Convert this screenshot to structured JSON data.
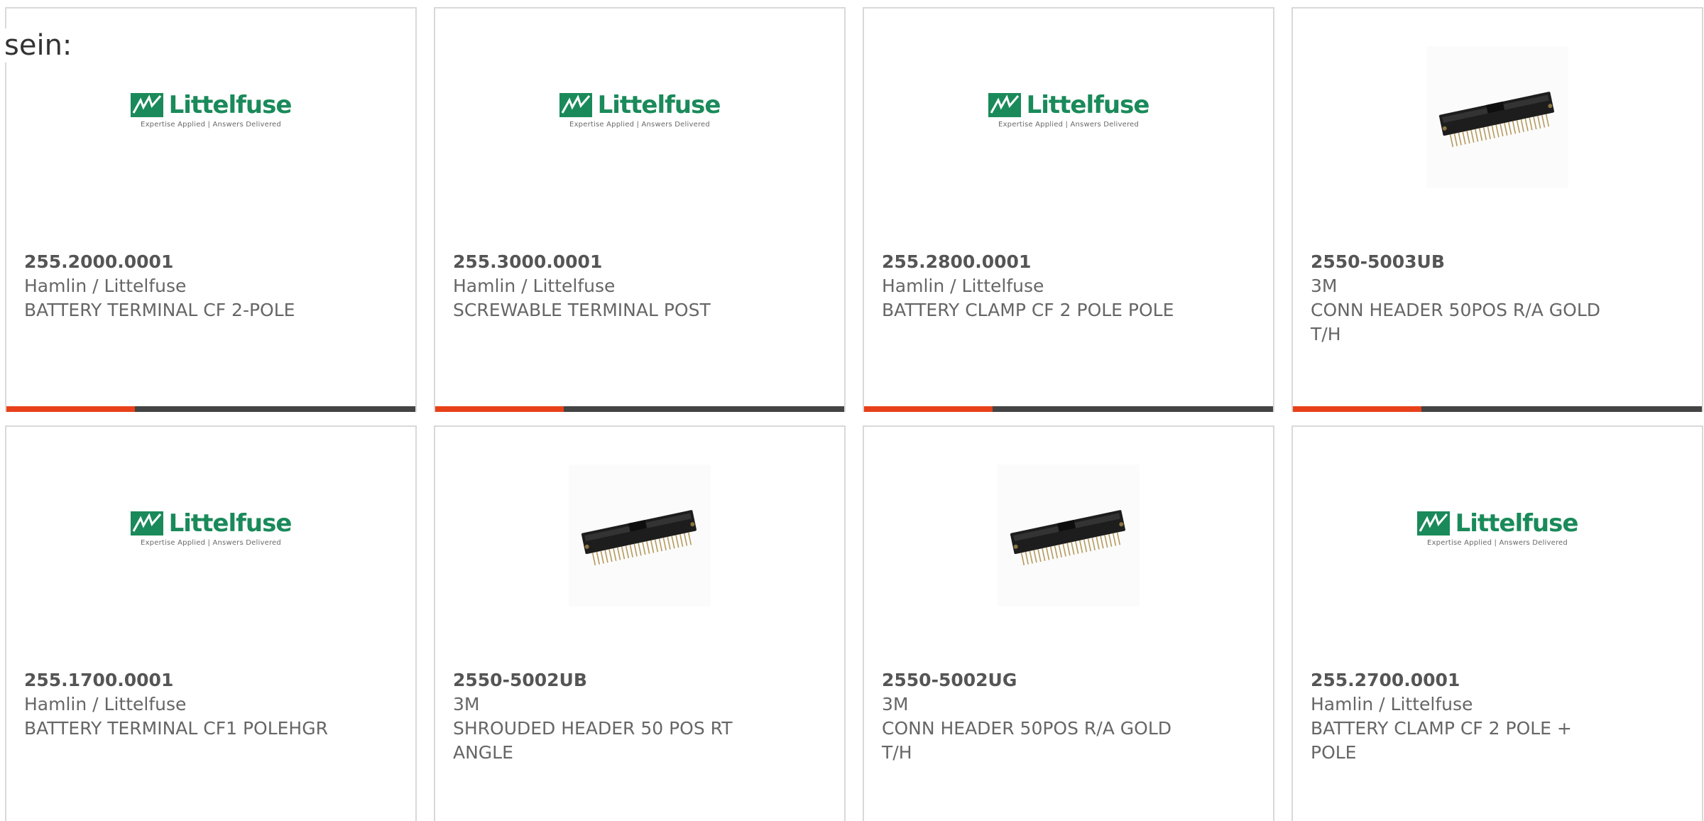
{
  "intro_text": "sein:",
  "accent_color": "#e8411a",
  "progress_fraction": 0.315,
  "products": [
    {
      "part_number": "255.2000.0001",
      "manufacturer": "Hamlin / Littelfuse",
      "description": "BATTERY TERMINAL CF 2-POLE",
      "image": "littelfuse-logo",
      "logo": {
        "wordmark": "Littelfuse",
        "tagline": "Expertise Applied  |  Answers Delivered"
      }
    },
    {
      "part_number": "255.3000.0001",
      "manufacturer": "Hamlin / Littelfuse",
      "description": "SCREWABLE TERMINAL POST",
      "image": "littelfuse-logo",
      "logo": {
        "wordmark": "Littelfuse",
        "tagline": "Expertise Applied  |  Answers Delivered"
      }
    },
    {
      "part_number": "255.2800.0001",
      "manufacturer": "Hamlin / Littelfuse",
      "description": "BATTERY CLAMP CF 2 POLE POLE",
      "image": "littelfuse-logo",
      "logo": {
        "wordmark": "Littelfuse",
        "tagline": "Expertise Applied  |  Answers Delivered"
      }
    },
    {
      "part_number": "2550-5003UB",
      "manufacturer": "3M",
      "description": "CONN HEADER 50POS R/A GOLD T/H",
      "image": "connector-header-photo"
    },
    {
      "part_number": "255.1700.0001",
      "manufacturer": "Hamlin / Littelfuse",
      "description": "BATTERY TERMINAL CF1 POLEHGR",
      "image": "littelfuse-logo",
      "logo": {
        "wordmark": "Littelfuse",
        "tagline": "Expertise Applied  |  Answers Delivered"
      }
    },
    {
      "part_number": "2550-5002UB",
      "manufacturer": "3M",
      "description": "SHROUDED HEADER 50 POS RT ANGLE",
      "image": "connector-header-photo"
    },
    {
      "part_number": "2550-5002UG",
      "manufacturer": "3M",
      "description": "CONN HEADER 50POS R/A GOLD T/H",
      "image": "connector-header-photo"
    },
    {
      "part_number": "255.2700.0001",
      "manufacturer": "Hamlin / Littelfuse",
      "description": "BATTERY CLAMP CF 2 POLE + POLE",
      "image": "littelfuse-logo",
      "logo": {
        "wordmark": "Littelfuse",
        "tagline": "Expertise Applied  |  Answers Delivered"
      }
    }
  ]
}
